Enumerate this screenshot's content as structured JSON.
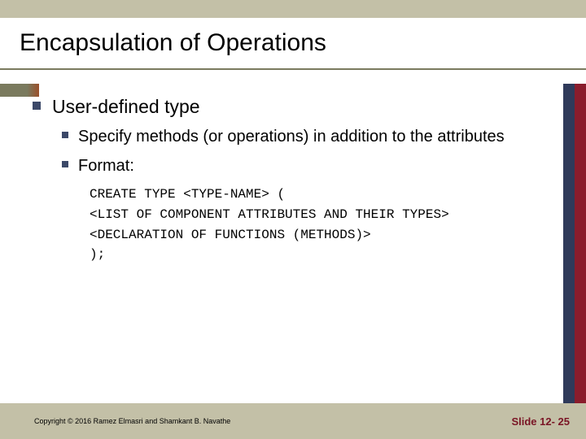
{
  "title": "Encapsulation of Operations",
  "bullet1": "User-defined type",
  "sub1": "Specify methods (or operations) in addition to the attributes",
  "sub2": "Format:",
  "code": "CREATE TYPE <TYPE-NAME> (\n<LIST OF COMPONENT ATTRIBUTES AND THEIR TYPES>\n<DECLARATION OF FUNCTIONS (METHODS)>\n);",
  "copyright": "Copyright © 2016 Ramez Elmasri and Shamkant B. Navathe",
  "slide_number": "Slide 12- 25"
}
